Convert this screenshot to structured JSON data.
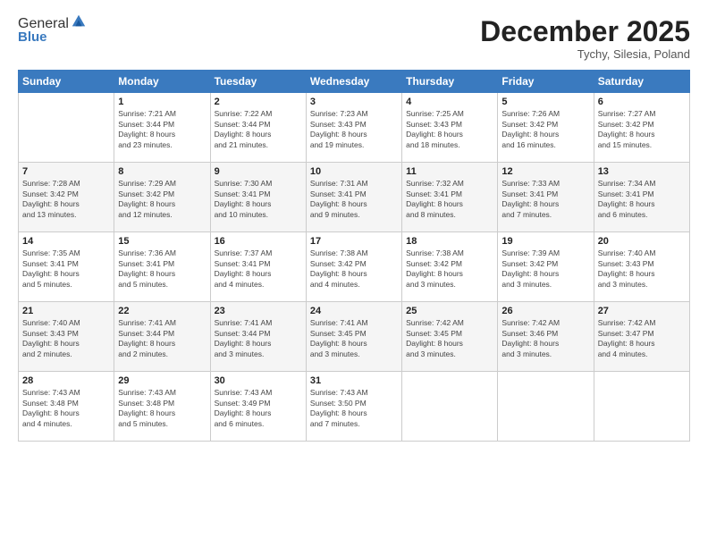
{
  "logo": {
    "general": "General",
    "blue": "Blue"
  },
  "header": {
    "month": "December 2025",
    "location": "Tychy, Silesia, Poland"
  },
  "days_of_week": [
    "Sunday",
    "Monday",
    "Tuesday",
    "Wednesday",
    "Thursday",
    "Friday",
    "Saturday"
  ],
  "weeks": [
    [
      {
        "day": "",
        "info": ""
      },
      {
        "day": "1",
        "info": "Sunrise: 7:21 AM\nSunset: 3:44 PM\nDaylight: 8 hours\nand 23 minutes."
      },
      {
        "day": "2",
        "info": "Sunrise: 7:22 AM\nSunset: 3:44 PM\nDaylight: 8 hours\nand 21 minutes."
      },
      {
        "day": "3",
        "info": "Sunrise: 7:23 AM\nSunset: 3:43 PM\nDaylight: 8 hours\nand 19 minutes."
      },
      {
        "day": "4",
        "info": "Sunrise: 7:25 AM\nSunset: 3:43 PM\nDaylight: 8 hours\nand 18 minutes."
      },
      {
        "day": "5",
        "info": "Sunrise: 7:26 AM\nSunset: 3:42 PM\nDaylight: 8 hours\nand 16 minutes."
      },
      {
        "day": "6",
        "info": "Sunrise: 7:27 AM\nSunset: 3:42 PM\nDaylight: 8 hours\nand 15 minutes."
      }
    ],
    [
      {
        "day": "7",
        "info": "Sunrise: 7:28 AM\nSunset: 3:42 PM\nDaylight: 8 hours\nand 13 minutes."
      },
      {
        "day": "8",
        "info": "Sunrise: 7:29 AM\nSunset: 3:42 PM\nDaylight: 8 hours\nand 12 minutes."
      },
      {
        "day": "9",
        "info": "Sunrise: 7:30 AM\nSunset: 3:41 PM\nDaylight: 8 hours\nand 10 minutes."
      },
      {
        "day": "10",
        "info": "Sunrise: 7:31 AM\nSunset: 3:41 PM\nDaylight: 8 hours\nand 9 minutes."
      },
      {
        "day": "11",
        "info": "Sunrise: 7:32 AM\nSunset: 3:41 PM\nDaylight: 8 hours\nand 8 minutes."
      },
      {
        "day": "12",
        "info": "Sunrise: 7:33 AM\nSunset: 3:41 PM\nDaylight: 8 hours\nand 7 minutes."
      },
      {
        "day": "13",
        "info": "Sunrise: 7:34 AM\nSunset: 3:41 PM\nDaylight: 8 hours\nand 6 minutes."
      }
    ],
    [
      {
        "day": "14",
        "info": "Sunrise: 7:35 AM\nSunset: 3:41 PM\nDaylight: 8 hours\nand 5 minutes."
      },
      {
        "day": "15",
        "info": "Sunrise: 7:36 AM\nSunset: 3:41 PM\nDaylight: 8 hours\nand 5 minutes."
      },
      {
        "day": "16",
        "info": "Sunrise: 7:37 AM\nSunset: 3:41 PM\nDaylight: 8 hours\nand 4 minutes."
      },
      {
        "day": "17",
        "info": "Sunrise: 7:38 AM\nSunset: 3:42 PM\nDaylight: 8 hours\nand 4 minutes."
      },
      {
        "day": "18",
        "info": "Sunrise: 7:38 AM\nSunset: 3:42 PM\nDaylight: 8 hours\nand 3 minutes."
      },
      {
        "day": "19",
        "info": "Sunrise: 7:39 AM\nSunset: 3:42 PM\nDaylight: 8 hours\nand 3 minutes."
      },
      {
        "day": "20",
        "info": "Sunrise: 7:40 AM\nSunset: 3:43 PM\nDaylight: 8 hours\nand 3 minutes."
      }
    ],
    [
      {
        "day": "21",
        "info": "Sunrise: 7:40 AM\nSunset: 3:43 PM\nDaylight: 8 hours\nand 2 minutes."
      },
      {
        "day": "22",
        "info": "Sunrise: 7:41 AM\nSunset: 3:44 PM\nDaylight: 8 hours\nand 2 minutes."
      },
      {
        "day": "23",
        "info": "Sunrise: 7:41 AM\nSunset: 3:44 PM\nDaylight: 8 hours\nand 3 minutes."
      },
      {
        "day": "24",
        "info": "Sunrise: 7:41 AM\nSunset: 3:45 PM\nDaylight: 8 hours\nand 3 minutes."
      },
      {
        "day": "25",
        "info": "Sunrise: 7:42 AM\nSunset: 3:45 PM\nDaylight: 8 hours\nand 3 minutes."
      },
      {
        "day": "26",
        "info": "Sunrise: 7:42 AM\nSunset: 3:46 PM\nDaylight: 8 hours\nand 3 minutes."
      },
      {
        "day": "27",
        "info": "Sunrise: 7:42 AM\nSunset: 3:47 PM\nDaylight: 8 hours\nand 4 minutes."
      }
    ],
    [
      {
        "day": "28",
        "info": "Sunrise: 7:43 AM\nSunset: 3:48 PM\nDaylight: 8 hours\nand 4 minutes."
      },
      {
        "day": "29",
        "info": "Sunrise: 7:43 AM\nSunset: 3:48 PM\nDaylight: 8 hours\nand 5 minutes."
      },
      {
        "day": "30",
        "info": "Sunrise: 7:43 AM\nSunset: 3:49 PM\nDaylight: 8 hours\nand 6 minutes."
      },
      {
        "day": "31",
        "info": "Sunrise: 7:43 AM\nSunset: 3:50 PM\nDaylight: 8 hours\nand 7 minutes."
      },
      {
        "day": "",
        "info": ""
      },
      {
        "day": "",
        "info": ""
      },
      {
        "day": "",
        "info": ""
      }
    ]
  ]
}
